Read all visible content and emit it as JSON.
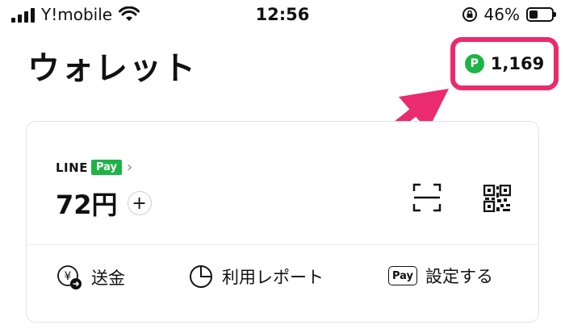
{
  "status_bar": {
    "carrier": "Y!mobile",
    "time": "12:56",
    "battery_percent": "46%",
    "battery_level": 0.46
  },
  "page": {
    "title": "ウォレット"
  },
  "points": {
    "icon_letter": "P",
    "value": "1,169",
    "highlight_color": "#ea2b6d",
    "icon_color": "#1db446"
  },
  "line_pay": {
    "brand_line": "LINE",
    "brand_pay": "Pay",
    "balance": "72円",
    "add_label": "+"
  },
  "actions": {
    "send": {
      "label": "送金",
      "icon": "yen-send-icon"
    },
    "report": {
      "label": "利用レポート",
      "icon": "pie-chart-icon"
    },
    "settings": {
      "label": "設定する",
      "icon": "apple-pay-icon",
      "icon_text": "Pay"
    }
  },
  "icons": {
    "scan": "scan-icon",
    "qr": "qr-code-icon"
  }
}
